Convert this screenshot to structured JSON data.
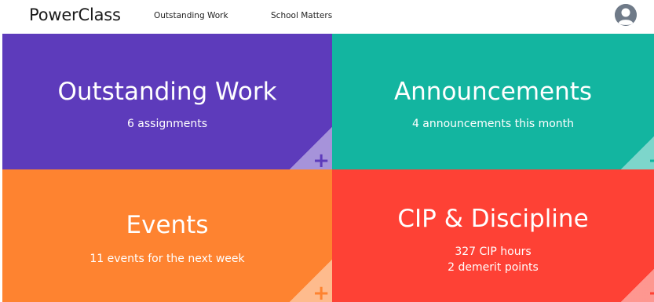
{
  "header": {
    "brand": "PowerClass",
    "nav": [
      {
        "label": "Outstanding Work"
      },
      {
        "label": "School Matters"
      }
    ]
  },
  "tiles": [
    {
      "title": "Outstanding Work",
      "lines": [
        "6 assignments"
      ],
      "color": "#5d3bbb",
      "action_icon": "plus-icon",
      "action_label": "+"
    },
    {
      "title": "Announcements",
      "lines": [
        "4 announcements this month"
      ],
      "color": "#13b5a0",
      "action_icon": "plus-icon",
      "action_label": "+"
    },
    {
      "title": "Events",
      "lines": [
        "11 events for the next week"
      ],
      "color": "#fe8330",
      "action_icon": "plus-icon",
      "action_label": "+"
    },
    {
      "title": "CIP & Discipline",
      "lines": [
        "327 CIP hours",
        "2 demerit points"
      ],
      "color": "#fe4135",
      "action_icon": "plus-icon",
      "action_label": "+"
    }
  ]
}
